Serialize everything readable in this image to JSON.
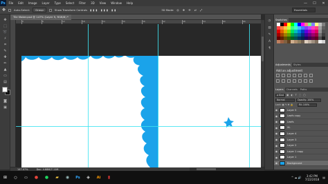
{
  "app": {
    "logo": "Ps",
    "window_controls": [
      "—",
      "☐",
      "✕"
    ]
  },
  "menu": [
    "File",
    "Edit",
    "Image",
    "Layer",
    "Type",
    "Select",
    "Filter",
    "3D",
    "View",
    "Window",
    "Help"
  ],
  "options": {
    "auto_select_label": "Auto-Select:",
    "auto_select_value": "Group",
    "show_transform_label": "Show Transform Controls",
    "mode_label": "3D Mode:",
    "workspace": "Essentials"
  },
  "document": {
    "tab_title": "Tile Maker.psd @ 147% (Layer 9, RGB/8) *",
    "zoom": "147.07%",
    "doc_size": "Doc: 4.88M/7.11M",
    "ruler_labels": [
      "0",
      "6",
      "12",
      "18",
      "24",
      "30",
      "36",
      "42",
      "48",
      "54",
      "60",
      "66"
    ]
  },
  "panels": {
    "swatches_tab": "Swatches",
    "adjustments_tab": "Adjustments",
    "styles_tab": "Styles",
    "add_adjustment": "Add an adjustment",
    "layers_tabs": [
      "Layers",
      "Channels",
      "Paths"
    ],
    "blend_mode": "Normal",
    "opacity_label": "Opacity: 100%",
    "fill_label": "Fill: 100%",
    "layers": [
      {
        "name": "Layer 5",
        "thumb": "white",
        "selected": false
      },
      {
        "name": "Leafs copy",
        "thumb": "white",
        "selected": false
      },
      {
        "name": "Leafs",
        "thumb": "white",
        "selected": false
      },
      {
        "name": "XL",
        "thumb": "white",
        "selected": false
      },
      {
        "name": "Layer 4",
        "thumb": "white",
        "selected": false
      },
      {
        "name": "Layer 3",
        "thumb": "white",
        "selected": false
      },
      {
        "name": "Layer 2",
        "thumb": "white",
        "selected": false
      },
      {
        "name": "Layer 1 copy",
        "thumb": "white",
        "selected": false
      },
      {
        "name": "Layer 1",
        "thumb": "white",
        "selected": false
      },
      {
        "name": "Background",
        "thumb": "blue",
        "selected": true
      }
    ]
  },
  "colors": {
    "accent_blue": "#1aa3ea",
    "guide": "#3ee3f1"
  },
  "taskbar": {
    "time": "3:42 PM",
    "date": "7/22/2018"
  }
}
